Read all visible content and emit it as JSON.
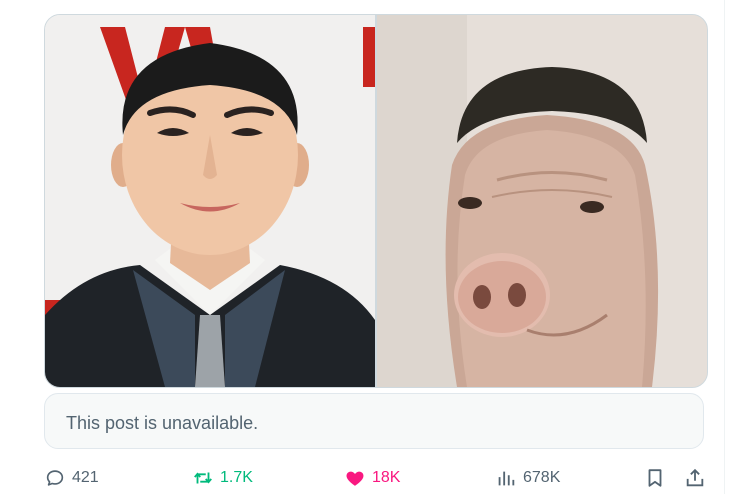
{
  "post": {
    "media": [
      {
        "icon": "portrait-photo"
      },
      {
        "icon": "pig-photo"
      }
    ],
    "unavailable_text": "This post is unavailable.",
    "actions": {
      "replies": "421",
      "reposts": "1.7K",
      "likes": "18K",
      "views": "678K"
    }
  },
  "colors": {
    "secondary_text": "#536471",
    "repost_active": "#00ba7c",
    "like_active": "#f91880",
    "border": "#cfd9de"
  }
}
